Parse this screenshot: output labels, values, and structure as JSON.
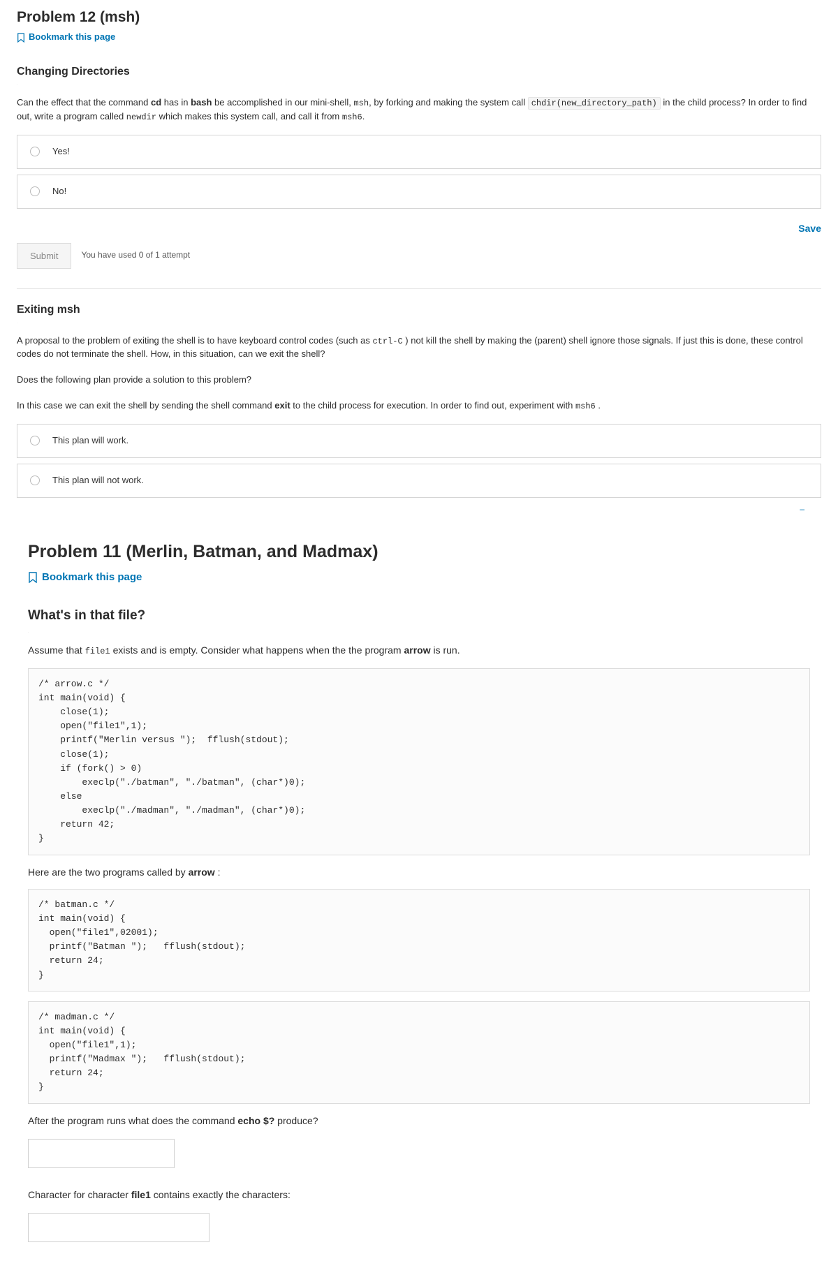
{
  "p12": {
    "title": "Problem 12 (msh)",
    "bookmark": "Bookmark this page",
    "sect1": {
      "heading": "Changing Directories",
      "txt": {
        "a": "Can the effect that the command ",
        "cd": "cd",
        "b": " has in ",
        "bash": "bash",
        "c": " be accomplished in our mini-shell, ",
        "msh": "msh",
        "d": ", by forking and making the system call ",
        "chdir": "chdir(new_directory_path)",
        "e": " in the child process? In order to find out, write a program called ",
        "newdir": "newdir",
        "f": " which makes this system call, and call it from ",
        "msh6": "msh6",
        "g": "."
      },
      "opts": {
        "yes": "Yes!",
        "no": "No!"
      },
      "save": "Save",
      "submit": "Submit",
      "attempts": "You have used 0 of 1 attempt"
    },
    "sect2": {
      "heading": "Exiting msh",
      "p1": {
        "a": "A proposal to the problem of exiting the shell is to have keyboard control codes (such as ",
        "ctrlc": "ctrl-C",
        "b": " ) not kill the shell by making the (parent) shell ignore those signals. If just this is done, these control codes do not terminate the shell. How, in this situation, can we exit the shell?"
      },
      "p2": "Does the following plan provide a solution to this problem?",
      "p3": {
        "a": "In this case we can exit the shell by sending the shell command ",
        "exit": "exit",
        "b": " to the child process for execution. In order to find out, experiment with ",
        "msh6": "msh6",
        "c": " ."
      },
      "opts": {
        "work": "This plan will work.",
        "notwork": "This plan will not work."
      }
    }
  },
  "caret": "–",
  "p11": {
    "title": "Problem 11 (Merlin, Batman, and Madmax)",
    "bookmark": "Bookmark this page",
    "sect1": {
      "heading": "What's in that file?",
      "intro": {
        "a": "Assume that ",
        "file1": "file1",
        "b": " exists and is empty. Consider what happens when the the program ",
        "arrow": "arrow",
        "c": " is run."
      },
      "code_arrow": "/* arrow.c */\nint main(void) {\n    close(1);\n    open(\"file1\",1);\n    printf(\"Merlin versus \");  fflush(stdout);\n    close(1);\n    if (fork() > 0)\n        execlp(\"./batman\", \"./batman\", (char*)0);\n    else\n        execlp(\"./madman\", \"./madman\", (char*)0);\n    return 42;\n}",
      "mid": {
        "a": "Here are the two programs called by ",
        "arrow": "arrow",
        "b": " :"
      },
      "code_batman": "/* batman.c */\nint main(void) {\n  open(\"file1\",02001);\n  printf(\"Batman \");   fflush(stdout);\n  return 24;\n}",
      "code_madman": "/* madman.c */\nint main(void) {\n  open(\"file1\",1);\n  printf(\"Madmax \");   fflush(stdout);\n  return 24;\n}",
      "q1": {
        "a": "After the program runs what does the command ",
        "echo": "echo $?",
        "b": " produce?"
      },
      "q2": {
        "a": "Character for character ",
        "file1": "file1",
        "b": " contains exactly the characters:"
      }
    }
  }
}
